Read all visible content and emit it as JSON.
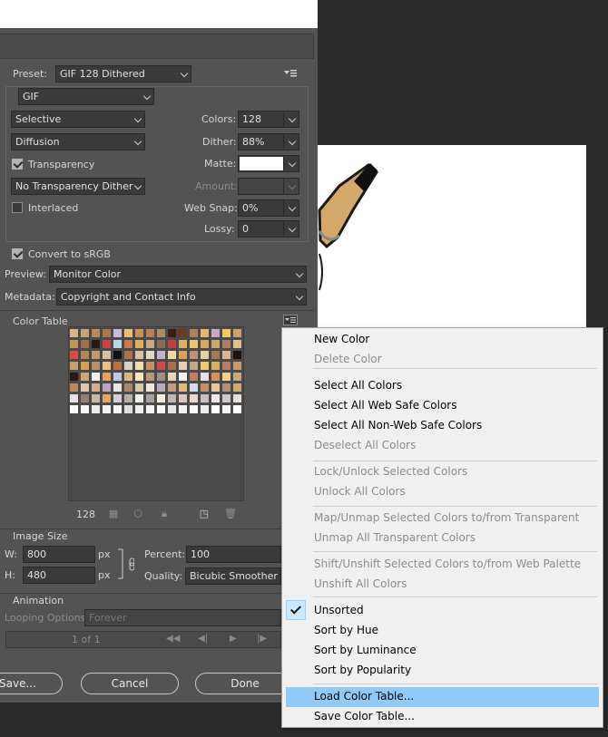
{
  "settings": {
    "preset_label": "Preset:",
    "preset_value": "GIF 128 Dithered",
    "format_value": "GIF",
    "reduction_value": "Selective",
    "dither_algo_value": "Diffusion",
    "transparency_label": "Transparency",
    "transparency_checked": true,
    "transparency_dither_value": "No Transparency Dither",
    "interlaced_label": "Interlaced",
    "interlaced_checked": false,
    "colors_label": "Colors:",
    "colors_value": "128",
    "dither_label": "Dither:",
    "dither_value": "88%",
    "matte_label": "Matte:",
    "matte_color": "#ffffff",
    "amount_label": "Amount:",
    "websnap_label": "Web Snap:",
    "websnap_value": "0%",
    "lossy_label": "Lossy:",
    "lossy_value": "0",
    "convert_label": "Convert to sRGB",
    "convert_checked": true,
    "preview_label": "Preview:",
    "preview_value": "Monitor Color",
    "metadata_label": "Metadata:",
    "metadata_value": "Copyright and Contact Info"
  },
  "color_table": {
    "title": "Color Table",
    "count": "128",
    "swatches": [
      "#d8b48c",
      "#c9a27a",
      "#b88a5e",
      "#a8784a",
      "#cbb8d8",
      "#e8c070",
      "#c8905a",
      "#bc8050",
      "#b08a60",
      "#3a1e14",
      "#6a3a22",
      "#a8845a",
      "#e4b870",
      "#c8a8c8",
      "#f0c864",
      "#caa06c",
      "#c0965c",
      "#a07048",
      "#2c1810",
      "#d04040",
      "#b8d8e8",
      "#c87850",
      "#e0b060",
      "#caa880",
      "#8a6a5a",
      "#c04040",
      "#d8b060",
      "#e8c878",
      "#d4a860",
      "#caa870",
      "#a88060",
      "#e0c088",
      "#e04848",
      "#b08858",
      "#c89868",
      "#d8c0a0",
      "#101018",
      "#b07040",
      "#d8c4a0",
      "#e0d8c8",
      "#c8b0d0",
      "#f0d8a0",
      "#d8a060",
      "#c09070",
      "#e8d0a0",
      "#a87850",
      "#d8b890",
      "#1e1210",
      "#c8a070",
      "#d8a050",
      "#b89070",
      "#e8c080",
      "#c07040",
      "#d8d0c8",
      "#f0e0b0",
      "#c89060",
      "#d04848",
      "#a87048",
      "#e8d0b0",
      "#c0a890",
      "#f0c870",
      "#d8b068",
      "#b08060",
      "#c89870",
      "#281810",
      "#c8a878",
      "#f0f0f0",
      "#e8a060",
      "#c0c8e8",
      "#d8b880",
      "#f8e8c0",
      "#b89878",
      "#a09080",
      "#e8d8b8",
      "#f4f4f4",
      "#c08060",
      "#e0e0f0",
      "#d89058",
      "#f0d090",
      "#c8a880",
      "#b88860",
      "#e0c8a8",
      "#d0b090",
      "#c0a0c0",
      "#e8e8e8",
      "#a88868",
      "#d8c8b0",
      "#f0e8d8",
      "#b8a8c0",
      "#c89878",
      "#e0b878",
      "#d8d8e8",
      "#c89060",
      "#e8c898",
      "#b09078",
      "#d0a878",
      "#e8e0e8",
      "#908078",
      "#c8b8a8",
      "#e0a868",
      "#d8d0d8",
      "#b8b0a8",
      "#f0f0e8",
      "#a8a0a0",
      "#f8f0e0",
      "#c0b8b8",
      "#d8c8c0",
      "#e8d8d0",
      "#c8c0c0",
      "#f0e8e8",
      "#d0c8c8",
      "#e8e0d8",
      "#ffffff",
      "#f8f8f8",
      "#ececec",
      "#f4f4f4",
      "#fafafa",
      "#e0e0e0",
      "#f0f0f0",
      "#f6f6f6",
      "#fcfcfc",
      "#e8e8e8",
      "#f2f2f2",
      "#f9f9f9",
      "#eeeeee",
      "#fdfdfd",
      "#f7f7f7",
      "#ffffff"
    ]
  },
  "image_size": {
    "title": "Image Size",
    "w_label": "W:",
    "w_value": "800",
    "h_label": "H:",
    "h_value": "480",
    "unit": "px",
    "percent_label": "Percent:",
    "percent_value": "100",
    "quality_label": "Quality:",
    "quality_value": "Bicubic Smoother"
  },
  "animation": {
    "title": "Animation",
    "looping_label": "Looping Options:",
    "looping_value": "Forever",
    "frame_text": "1 of 1"
  },
  "buttons": {
    "save": "Save...",
    "cancel": "Cancel",
    "done": "Done"
  },
  "menu": {
    "items": [
      {
        "label": "New Color",
        "disabled": false
      },
      {
        "label": "Delete Color",
        "disabled": true
      },
      {
        "label": "Select All Colors",
        "disabled": false
      },
      {
        "label": "Select All Web Safe Colors",
        "disabled": false
      },
      {
        "label": "Select All Non-Web Safe Colors",
        "disabled": false
      },
      {
        "label": "Deselect All Colors",
        "disabled": true
      },
      {
        "label": "Lock/Unlock Selected Colors",
        "disabled": true
      },
      {
        "label": "Unlock All Colors",
        "disabled": true
      },
      {
        "label": "Map/Unmap Selected Colors to/from Transparent",
        "disabled": true
      },
      {
        "label": "Unmap All Transparent Colors",
        "disabled": true
      },
      {
        "label": "Shift/Unshift Selected Colors to/from Web Palette",
        "disabled": true
      },
      {
        "label": "Unshift All Colors",
        "disabled": true
      },
      {
        "label": "Unsorted",
        "disabled": false,
        "checked": true
      },
      {
        "label": "Sort by Hue",
        "disabled": false
      },
      {
        "label": "Sort by Luminance",
        "disabled": false
      },
      {
        "label": "Sort by Popularity",
        "disabled": false
      },
      {
        "label": "Load Color Table...",
        "disabled": false,
        "highlighted": true
      },
      {
        "label": "Save Color Table...",
        "disabled": false
      }
    ]
  }
}
